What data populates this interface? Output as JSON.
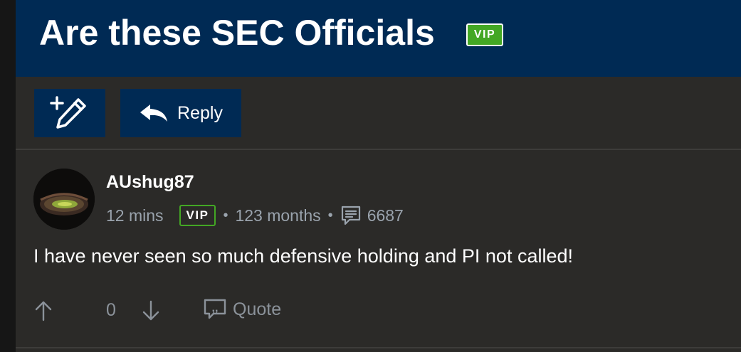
{
  "thread": {
    "title": "Are these SEC Officials",
    "badge": "VIP"
  },
  "toolbar": {
    "new_post_icon": "pencil-plus-icon",
    "reply_label": "Reply"
  },
  "post": {
    "author": "AUshug87",
    "time": "12 mins",
    "badge": "VIP",
    "separator": "•",
    "tenure": "123 months",
    "post_count": "6687",
    "body": "I have never seen so much defensive holding and PI not called!",
    "votes": "0",
    "quote_label": "Quote"
  },
  "colors": {
    "header_bg": "#002a54",
    "page_bg": "#2b2a28",
    "vip_green": "#43a724",
    "meta_text": "#9aa3ad"
  }
}
